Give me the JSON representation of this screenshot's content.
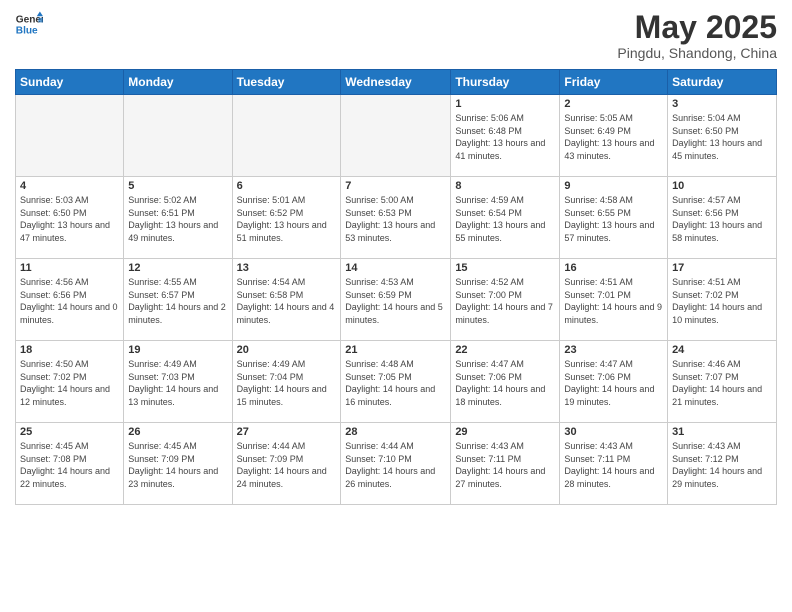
{
  "logo": {
    "line1": "General",
    "line2": "Blue"
  },
  "title": "May 2025",
  "subtitle": "Pingdu, Shandong, China",
  "days_of_week": [
    "Sunday",
    "Monday",
    "Tuesday",
    "Wednesday",
    "Thursday",
    "Friday",
    "Saturday"
  ],
  "weeks": [
    [
      {
        "day": "",
        "info": ""
      },
      {
        "day": "",
        "info": ""
      },
      {
        "day": "",
        "info": ""
      },
      {
        "day": "",
        "info": ""
      },
      {
        "day": "1",
        "info": "Sunrise: 5:06 AM\nSunset: 6:48 PM\nDaylight: 13 hours\nand 41 minutes."
      },
      {
        "day": "2",
        "info": "Sunrise: 5:05 AM\nSunset: 6:49 PM\nDaylight: 13 hours\nand 43 minutes."
      },
      {
        "day": "3",
        "info": "Sunrise: 5:04 AM\nSunset: 6:50 PM\nDaylight: 13 hours\nand 45 minutes."
      }
    ],
    [
      {
        "day": "4",
        "info": "Sunrise: 5:03 AM\nSunset: 6:50 PM\nDaylight: 13 hours\nand 47 minutes."
      },
      {
        "day": "5",
        "info": "Sunrise: 5:02 AM\nSunset: 6:51 PM\nDaylight: 13 hours\nand 49 minutes."
      },
      {
        "day": "6",
        "info": "Sunrise: 5:01 AM\nSunset: 6:52 PM\nDaylight: 13 hours\nand 51 minutes."
      },
      {
        "day": "7",
        "info": "Sunrise: 5:00 AM\nSunset: 6:53 PM\nDaylight: 13 hours\nand 53 minutes."
      },
      {
        "day": "8",
        "info": "Sunrise: 4:59 AM\nSunset: 6:54 PM\nDaylight: 13 hours\nand 55 minutes."
      },
      {
        "day": "9",
        "info": "Sunrise: 4:58 AM\nSunset: 6:55 PM\nDaylight: 13 hours\nand 57 minutes."
      },
      {
        "day": "10",
        "info": "Sunrise: 4:57 AM\nSunset: 6:56 PM\nDaylight: 13 hours\nand 58 minutes."
      }
    ],
    [
      {
        "day": "11",
        "info": "Sunrise: 4:56 AM\nSunset: 6:56 PM\nDaylight: 14 hours\nand 0 minutes."
      },
      {
        "day": "12",
        "info": "Sunrise: 4:55 AM\nSunset: 6:57 PM\nDaylight: 14 hours\nand 2 minutes."
      },
      {
        "day": "13",
        "info": "Sunrise: 4:54 AM\nSunset: 6:58 PM\nDaylight: 14 hours\nand 4 minutes."
      },
      {
        "day": "14",
        "info": "Sunrise: 4:53 AM\nSunset: 6:59 PM\nDaylight: 14 hours\nand 5 minutes."
      },
      {
        "day": "15",
        "info": "Sunrise: 4:52 AM\nSunset: 7:00 PM\nDaylight: 14 hours\nand 7 minutes."
      },
      {
        "day": "16",
        "info": "Sunrise: 4:51 AM\nSunset: 7:01 PM\nDaylight: 14 hours\nand 9 minutes."
      },
      {
        "day": "17",
        "info": "Sunrise: 4:51 AM\nSunset: 7:02 PM\nDaylight: 14 hours\nand 10 minutes."
      }
    ],
    [
      {
        "day": "18",
        "info": "Sunrise: 4:50 AM\nSunset: 7:02 PM\nDaylight: 14 hours\nand 12 minutes."
      },
      {
        "day": "19",
        "info": "Sunrise: 4:49 AM\nSunset: 7:03 PM\nDaylight: 14 hours\nand 13 minutes."
      },
      {
        "day": "20",
        "info": "Sunrise: 4:49 AM\nSunset: 7:04 PM\nDaylight: 14 hours\nand 15 minutes."
      },
      {
        "day": "21",
        "info": "Sunrise: 4:48 AM\nSunset: 7:05 PM\nDaylight: 14 hours\nand 16 minutes."
      },
      {
        "day": "22",
        "info": "Sunrise: 4:47 AM\nSunset: 7:06 PM\nDaylight: 14 hours\nand 18 minutes."
      },
      {
        "day": "23",
        "info": "Sunrise: 4:47 AM\nSunset: 7:06 PM\nDaylight: 14 hours\nand 19 minutes."
      },
      {
        "day": "24",
        "info": "Sunrise: 4:46 AM\nSunset: 7:07 PM\nDaylight: 14 hours\nand 21 minutes."
      }
    ],
    [
      {
        "day": "25",
        "info": "Sunrise: 4:45 AM\nSunset: 7:08 PM\nDaylight: 14 hours\nand 22 minutes."
      },
      {
        "day": "26",
        "info": "Sunrise: 4:45 AM\nSunset: 7:09 PM\nDaylight: 14 hours\nand 23 minutes."
      },
      {
        "day": "27",
        "info": "Sunrise: 4:44 AM\nSunset: 7:09 PM\nDaylight: 14 hours\nand 24 minutes."
      },
      {
        "day": "28",
        "info": "Sunrise: 4:44 AM\nSunset: 7:10 PM\nDaylight: 14 hours\nand 26 minutes."
      },
      {
        "day": "29",
        "info": "Sunrise: 4:43 AM\nSunset: 7:11 PM\nDaylight: 14 hours\nand 27 minutes."
      },
      {
        "day": "30",
        "info": "Sunrise: 4:43 AM\nSunset: 7:11 PM\nDaylight: 14 hours\nand 28 minutes."
      },
      {
        "day": "31",
        "info": "Sunrise: 4:43 AM\nSunset: 7:12 PM\nDaylight: 14 hours\nand 29 minutes."
      }
    ]
  ]
}
